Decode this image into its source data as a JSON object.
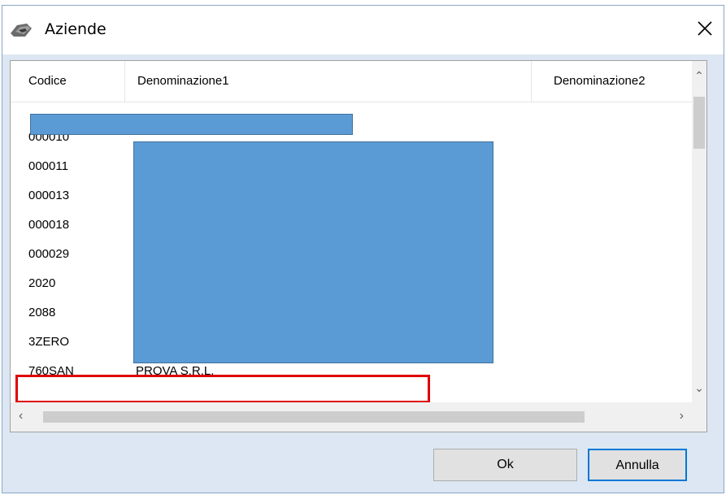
{
  "window": {
    "title": "Aziende",
    "close_symbol": "✕",
    "app_icon": "hand-document-icon"
  },
  "list": {
    "columns": [
      "Codice",
      "Denominazione1",
      "Denominazione2"
    ],
    "rows": [
      {
        "codice": "",
        "denominazione1": "",
        "denominazione2": ""
      },
      {
        "codice": "000010",
        "denominazione1": "",
        "denominazione2": ""
      },
      {
        "codice": "000011",
        "denominazione1": "",
        "denominazione2": ""
      },
      {
        "codice": "000013",
        "denominazione1": "",
        "denominazione2": ""
      },
      {
        "codice": "000018",
        "denominazione1": "",
        "denominazione2": ""
      },
      {
        "codice": "000029",
        "denominazione1": "",
        "denominazione2": ""
      },
      {
        "codice": "2020",
        "denominazione1": "",
        "denominazione2": ""
      },
      {
        "codice": "2088",
        "denominazione1": "",
        "denominazione2": ""
      },
      {
        "codice": "3ZERO",
        "denominazione1": "",
        "denominazione2": ""
      },
      {
        "codice": "760SAN",
        "denominazione1": "PROVA S.R.L.",
        "denominazione2": ""
      }
    ],
    "redaction_color": "#5b9bd5",
    "highlight_color": "#e00000"
  },
  "buttons": {
    "ok_label": "Ok",
    "cancel_label": "Annulla"
  }
}
